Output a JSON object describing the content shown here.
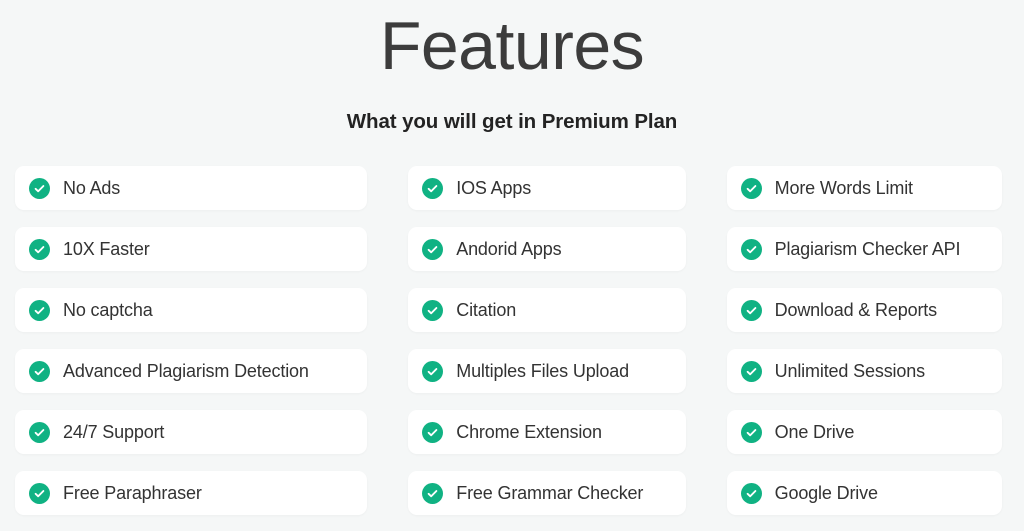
{
  "header": {
    "title": "Features",
    "subtitle": "What you will get in Premium Plan"
  },
  "theme": {
    "page_background": "#f5f7f7",
    "card_background": "#ffffff",
    "accent_green": "#10b283",
    "title_color": "#3c3c3c",
    "text_color": "#333333"
  },
  "icons": {
    "check": "check-circle-icon"
  },
  "columns": [
    {
      "items": [
        {
          "label": "No Ads",
          "icon": "check-circle-icon"
        },
        {
          "label": "10X Faster",
          "icon": "check-circle-icon"
        },
        {
          "label": "No captcha",
          "icon": "check-circle-icon"
        },
        {
          "label": "Advanced Plagiarism Detection",
          "icon": "check-circle-icon"
        },
        {
          "label": "24/7 Support",
          "icon": "check-circle-icon"
        },
        {
          "label": "Free Paraphraser",
          "icon": "check-circle-icon"
        }
      ]
    },
    {
      "items": [
        {
          "label": "IOS Apps",
          "icon": "check-circle-icon"
        },
        {
          "label": "Andorid Apps",
          "icon": "check-circle-icon"
        },
        {
          "label": "Citation",
          "icon": "check-circle-icon"
        },
        {
          "label": "Multiples Files Upload",
          "icon": "check-circle-icon"
        },
        {
          "label": "Chrome Extension",
          "icon": "check-circle-icon"
        },
        {
          "label": "Free Grammar Checker",
          "icon": "check-circle-icon"
        }
      ]
    },
    {
      "items": [
        {
          "label": "More Words Limit",
          "icon": "check-circle-icon"
        },
        {
          "label": "Plagiarism Checker API",
          "icon": "check-circle-icon"
        },
        {
          "label": "Download & Reports",
          "icon": "check-circle-icon"
        },
        {
          "label": "Unlimited Sessions",
          "icon": "check-circle-icon"
        },
        {
          "label": "One Drive",
          "icon": "check-circle-icon"
        },
        {
          "label": "Google Drive",
          "icon": "check-circle-icon"
        }
      ]
    }
  ]
}
